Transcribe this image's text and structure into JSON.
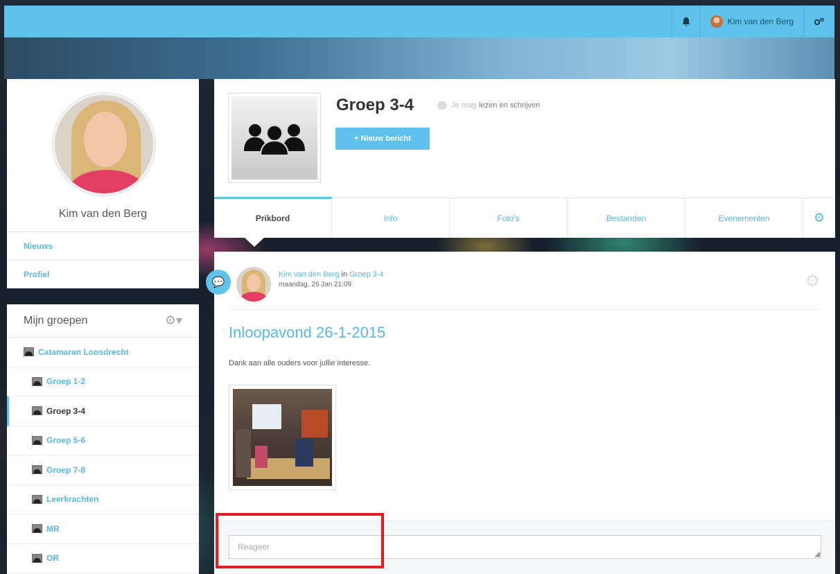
{
  "topbar": {
    "user_name": "Kim van den Berg",
    "icons": [
      "bell-icon",
      "cogs-icon"
    ]
  },
  "profile": {
    "name": "Kim van den Berg",
    "nav": [
      {
        "label": "Nieuws"
      },
      {
        "label": "Profiel"
      }
    ]
  },
  "groups": {
    "title": "Mijn groepen",
    "items": [
      {
        "label": "Catamaran Loosdrecht"
      },
      {
        "label": "Groep 1-2"
      },
      {
        "label": "Groep 3-4"
      },
      {
        "label": "Groep 5-6"
      },
      {
        "label": "Groep 7-8"
      },
      {
        "label": "Leerkrachten"
      },
      {
        "label": "MR"
      },
      {
        "label": "OR"
      }
    ]
  },
  "group": {
    "title": "Groep 3-4",
    "permission_prefix": "Je mag",
    "permission_text": "lezen en schrijven",
    "new_post_label": "+ Nieuw bericht",
    "tabs": [
      {
        "label": "Prikbord"
      },
      {
        "label": "Info"
      },
      {
        "label": "Foto's"
      },
      {
        "label": "Bestanden"
      },
      {
        "label": "Evenementen"
      }
    ]
  },
  "post": {
    "author": "Kim van den Berg",
    "in_word": "in",
    "group": "Groep 3-4",
    "date": "maandag, 26 Jan 21:09",
    "title": "Inloopavond 26-1-2015",
    "body": "Dank aan alle ouders voor jullie interesse.",
    "comment_placeholder": "Reageer"
  },
  "colors": {
    "accent": "#5ec2ea",
    "highlight": "#e01c24"
  }
}
